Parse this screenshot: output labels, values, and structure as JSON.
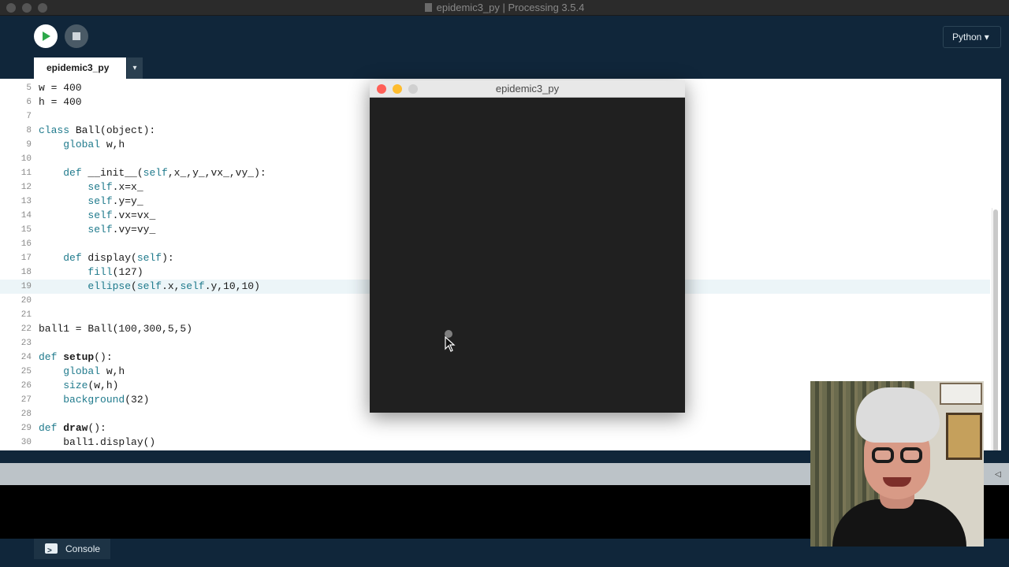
{
  "window": {
    "title": "epidemic3_py | Processing 3.5.4"
  },
  "toolbar": {
    "run_icon": "play-icon",
    "stop_icon": "stop-icon",
    "mode_label": "Python ▾"
  },
  "tabs": [
    {
      "label": "epidemic3_py"
    }
  ],
  "tab_menu_label": "▾",
  "editor": {
    "highlighted_line": 19,
    "lines": [
      {
        "num": "5",
        "text": "w = 400"
      },
      {
        "num": "6",
        "text": "h = 400"
      },
      {
        "num": "7",
        "text": ""
      },
      {
        "num": "8",
        "text": "class Ball(object):"
      },
      {
        "num": "9",
        "text": "    global w,h"
      },
      {
        "num": "10",
        "text": ""
      },
      {
        "num": "11",
        "text": "    def __init__(self,x_,y_,vx_,vy_):"
      },
      {
        "num": "12",
        "text": "        self.x=x_"
      },
      {
        "num": "13",
        "text": "        self.y=y_"
      },
      {
        "num": "14",
        "text": "        self.vx=vx_"
      },
      {
        "num": "15",
        "text": "        self.vy=vy_"
      },
      {
        "num": "16",
        "text": ""
      },
      {
        "num": "17",
        "text": "    def display(self):"
      },
      {
        "num": "18",
        "text": "        fill(127)"
      },
      {
        "num": "19",
        "text": "        ellipse(self.x,self.y,10,10)"
      },
      {
        "num": "20",
        "text": ""
      },
      {
        "num": "21",
        "text": ""
      },
      {
        "num": "22",
        "text": "ball1 = Ball(100,300,5,5)"
      },
      {
        "num": "23",
        "text": ""
      },
      {
        "num": "24",
        "text": "def setup():"
      },
      {
        "num": "25",
        "text": "    global w,h"
      },
      {
        "num": "26",
        "text": "    size(w,h)"
      },
      {
        "num": "27",
        "text": "    background(32)"
      },
      {
        "num": "28",
        "text": ""
      },
      {
        "num": "29",
        "text": "def draw():"
      },
      {
        "num": "30",
        "text": "    ball1.display()"
      }
    ]
  },
  "sketch_window": {
    "title": "epidemic3_py",
    "background": "#202020",
    "ball_fill": "#7f7f7f"
  },
  "console": {
    "tab_label": "Console",
    "icon": "terminal-icon"
  },
  "colors": {
    "toolbar_bg": "#10263a",
    "run_button": "#ffffff",
    "accent_green": "#2da84a",
    "keyword": "#1f7a8c",
    "close_red": "#ff5f57",
    "minimize_yellow": "#febc2e"
  }
}
